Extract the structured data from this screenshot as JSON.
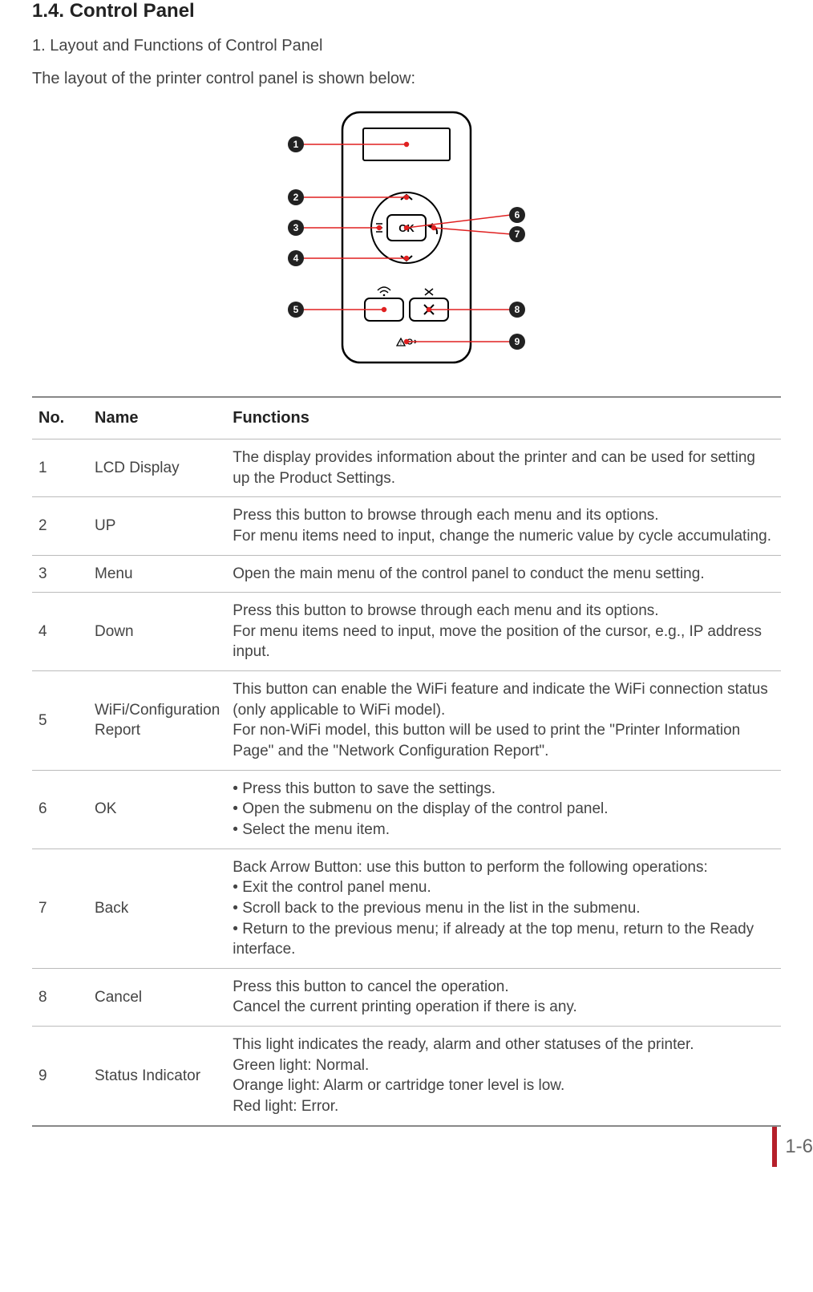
{
  "section": {
    "heading": "1.4. Control Panel",
    "subheading": "1. Layout and Functions of Control Panel",
    "intro": "The layout of the printer control panel is shown below:"
  },
  "diagram": {
    "callouts": [
      "1",
      "2",
      "3",
      "4",
      "5",
      "6",
      "7",
      "8",
      "9"
    ],
    "ok_label": "OK"
  },
  "table": {
    "headers": {
      "no": "No.",
      "name": "Name",
      "func": "Functions"
    },
    "rows": [
      {
        "no": "1",
        "name": "LCD Display",
        "func": "The display provides information about the printer and can be used for setting up the Product Settings."
      },
      {
        "no": "2",
        "name": "UP",
        "func": "Press this button to browse through each menu and its options.\nFor menu items need to input, change the numeric value by cycle accumulating."
      },
      {
        "no": "3",
        "name": "Menu",
        "func": "Open the main menu of the control panel to conduct the menu setting."
      },
      {
        "no": "4",
        "name": "Down",
        "func": "Press this button to browse through each menu and its options.\nFor menu items need to input, move the position of the cursor, e.g., IP address input."
      },
      {
        "no": "5",
        "name": "WiFi/Configuration Report",
        "func": "This button can enable the WiFi feature and indicate the WiFi connection status (only applicable to WiFi model).\nFor non-WiFi model, this button will be used to print the \"Printer Information Page\" and the \"Network Configuration Report\"."
      },
      {
        "no": "6",
        "name": "OK",
        "func": "• Press this button to save the settings.\n• Open the submenu on the display of the control panel.\n• Select the menu item."
      },
      {
        "no": "7",
        "name": "Back",
        "func": "Back Arrow Button: use this button to perform the following operations:\n• Exit the control panel menu.\n• Scroll back to the previous menu in the list in the submenu.\n• Return to the previous menu; if already at the top menu, return to the Ready interface."
      },
      {
        "no": "8",
        "name": "Cancel",
        "func": "Press this button to cancel the operation.\nCancel the current printing operation if there is any."
      },
      {
        "no": "9",
        "name": "Status Indicator",
        "func": "This light indicates the ready, alarm and other statuses of the printer.\nGreen light: Normal.\nOrange light: Alarm or cartridge toner level is low.\nRed light: Error."
      }
    ]
  },
  "page_number": "1-6"
}
